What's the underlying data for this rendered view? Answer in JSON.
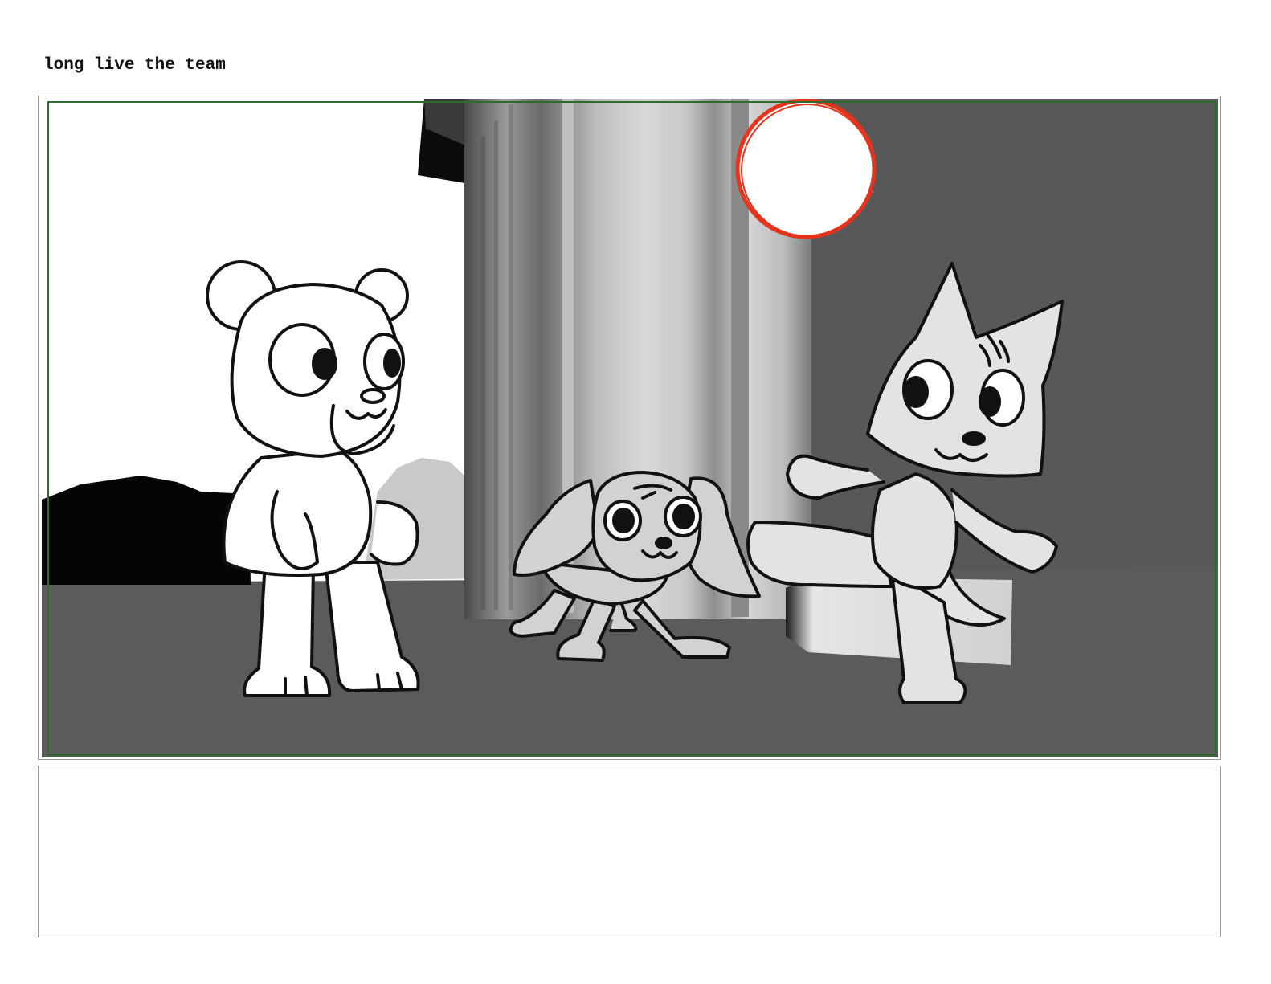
{
  "board": {
    "caption": "long live the team",
    "notes": ""
  },
  "panel": {
    "characters": [
      "bear",
      "puppy",
      "cat"
    ],
    "colors": {
      "sky": "#ffffff",
      "ground": "#5b5b5b",
      "wall": "#575757",
      "sun_outline": "#e5341c",
      "safe_frame": "#2f6b2f",
      "bear_fill": "#ffffff",
      "puppy_fill": "#d2d2d2",
      "cat_fill": "#e3e3e3",
      "line": "#111111"
    }
  }
}
